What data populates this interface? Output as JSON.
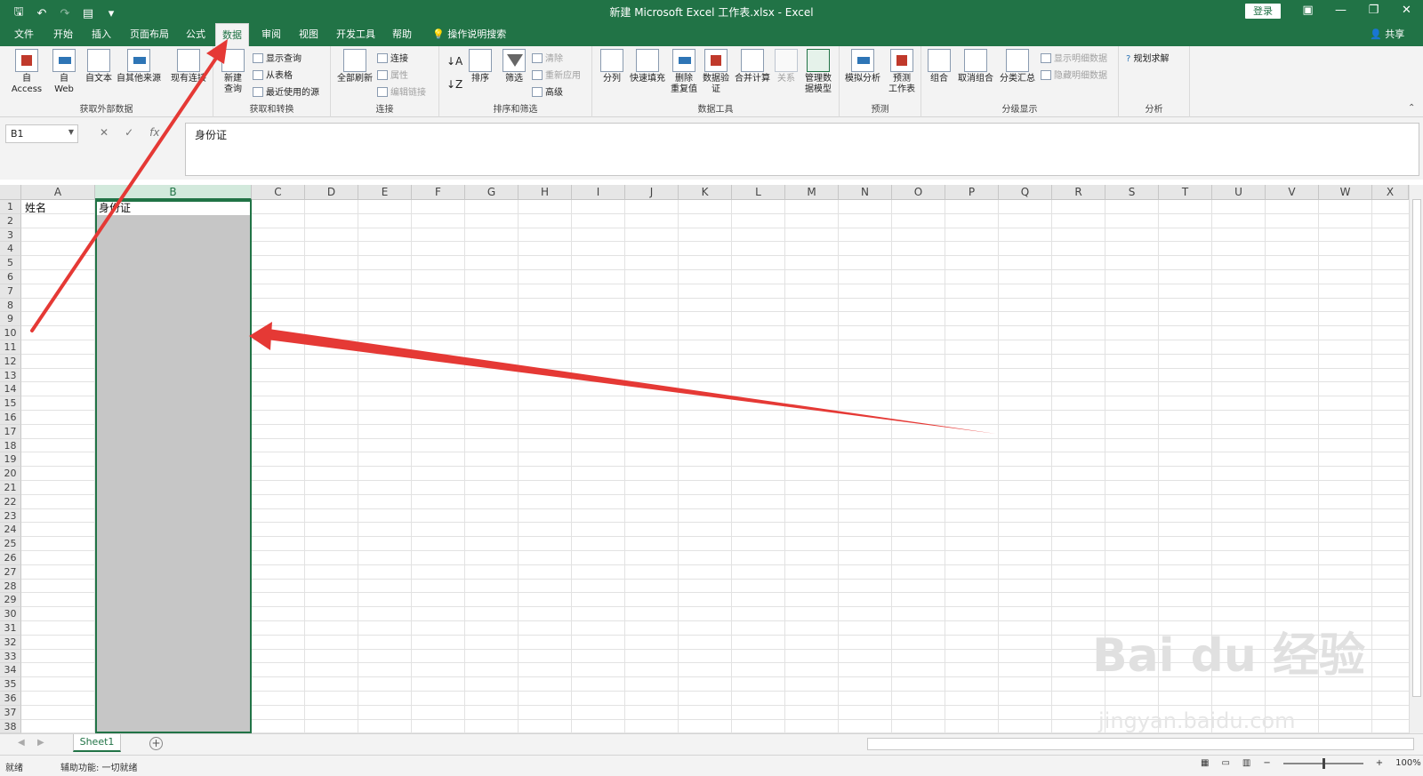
{
  "window": {
    "title": "新建 Microsoft Excel 工作表.xlsx  -  Excel",
    "login_label": "登录",
    "share_label": "共享"
  },
  "tabs": [
    {
      "label": "文件"
    },
    {
      "label": "开始"
    },
    {
      "label": "插入"
    },
    {
      "label": "页面布局"
    },
    {
      "label": "公式"
    },
    {
      "label": "数据"
    },
    {
      "label": "审阅"
    },
    {
      "label": "视图"
    },
    {
      "label": "开发工具"
    },
    {
      "label": "帮助"
    },
    {
      "label": "操作说明搜索"
    }
  ],
  "ribbon": {
    "get_external": {
      "label": "获取外部数据",
      "access": "自 Access",
      "web": "自\nWeb",
      "text": "自文本",
      "other": "自其他来源",
      "existing": "现有连接"
    },
    "get_transform": {
      "label": "获取和转换",
      "new_query": "新建\n查询",
      "show_query": "显示查询",
      "from_table": "从表格",
      "recent": "最近使用的源"
    },
    "connections": {
      "label": "连接",
      "refresh_all": "全部刷新",
      "connections": "连接",
      "properties": "属性",
      "edit_links": "编辑链接"
    },
    "sort_filter": {
      "label": "排序和筛选",
      "sort": "排序",
      "filter": "筛选",
      "clear": "清除",
      "reapply": "重新应用",
      "advanced": "高级"
    },
    "data_tools": {
      "label": "数据工具",
      "split": "分列",
      "flash_fill": "快速填充",
      "remove_dup": "删除\n重复值",
      "validation": "数据验\n证",
      "consolidate": "合并计算",
      "relations": "关系",
      "manage_model": "管理数\n据模型"
    },
    "forecast": {
      "label": "预测",
      "what_if": "模拟分析",
      "forecast_sheet": "预测\n工作表"
    },
    "outline": {
      "label": "分级显示",
      "group": "组合",
      "ungroup": "取消组合",
      "subtotal": "分类汇总",
      "show_detail": "显示明细数据",
      "hide_detail": "隐藏明细数据"
    },
    "analysis": {
      "label": "分析",
      "solver": "规划求解"
    }
  },
  "formula_bar": {
    "name_box": "B1",
    "formula": "身份证"
  },
  "grid": {
    "columns": [
      "A",
      "B",
      "C",
      "D",
      "E",
      "F",
      "G",
      "H",
      "I",
      "J",
      "K",
      "L",
      "M",
      "N",
      "O",
      "P",
      "Q",
      "R",
      "S",
      "T",
      "U",
      "V",
      "W",
      "X"
    ],
    "rows": [
      "1",
      "2",
      "3",
      "4",
      "5",
      "6",
      "7",
      "8",
      "9",
      "10",
      "11",
      "12",
      "13",
      "14",
      "15",
      "16",
      "17",
      "18",
      "19",
      "20",
      "21",
      "22",
      "23",
      "24",
      "25",
      "26",
      "27",
      "28",
      "29",
      "30",
      "31",
      "32",
      "33",
      "34",
      "35",
      "36",
      "37",
      "38"
    ],
    "cells": {
      "A1": "姓名",
      "B1": "身份证"
    },
    "selected_column": "B"
  },
  "sheets": [
    {
      "label": "Sheet1"
    }
  ],
  "status": {
    "ready": "就绪",
    "accessibility": "辅助功能: 一切就绪",
    "zoom": "100%"
  },
  "watermark": {
    "brand": "Bai du 经验",
    "url": "jingyan.baidu.com"
  },
  "colors": {
    "excel_green": "#217346",
    "arrow_red": "#e53935",
    "selection_fill": "#c6c6c6"
  }
}
